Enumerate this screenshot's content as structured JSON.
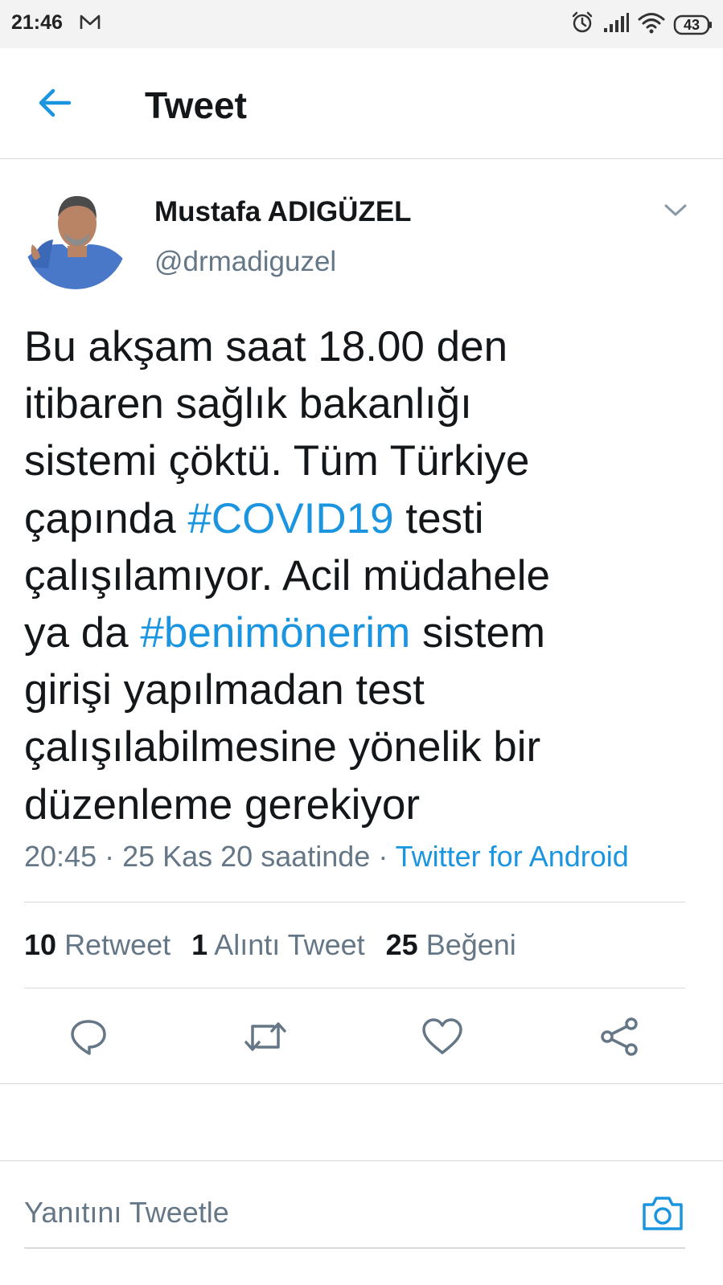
{
  "status_bar": {
    "time": "21:46",
    "battery": "43",
    "icons": [
      "mail-icon",
      "alarm-icon",
      "signal-icon",
      "wifi-icon",
      "battery-icon"
    ]
  },
  "header": {
    "title": "Tweet",
    "back_icon": "arrow-left-icon"
  },
  "tweet": {
    "author_name": "Mustafa ADIGÜZEL",
    "author_handle": "@drmadiguzel",
    "lines": [
      [
        "Bu akşam saat 18.00 den",
        "",
        ""
      ],
      [
        "itibaren sağlık bakanlığı",
        "",
        ""
      ],
      [
        "sistemi çöktü. Tüm Türkiye",
        "",
        ""
      ],
      [
        "çapında ",
        "#COVID19",
        " testi"
      ],
      [
        "çalışılamıyor. Acil müdahele",
        "",
        ""
      ],
      [
        "ya da ",
        "#benimönerim",
        " sistem"
      ],
      [
        "girişi yapılmadan test",
        "",
        ""
      ],
      [
        "çalışılabilmesine yönelik bir",
        "",
        ""
      ],
      [
        "düzenleme gerekiyor",
        "",
        ""
      ]
    ],
    "meta": "20:45 · 25 Kas 20 saatinde · ",
    "source": "Twitter for Android",
    "stats": {
      "retweets": "10",
      "retweets_label": "Retweet",
      "quotes": "1",
      "quotes_label": "Alıntı Tweet",
      "likes": "25",
      "likes_label": "Beğeni"
    }
  },
  "actions": [
    "reply-icon",
    "retweet-icon",
    "like-icon",
    "share-icon"
  ],
  "reply": {
    "placeholder": "Yanıtını Tweetle",
    "camera_icon": "camera-icon"
  },
  "colors": {
    "accent": "#1b95e0",
    "text": "#14171a",
    "secondary": "#657786",
    "divider": "#d9d9d9"
  }
}
